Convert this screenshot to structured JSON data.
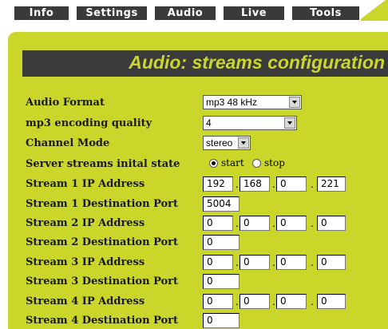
{
  "tabs": [
    "Info",
    "Settings",
    "Audio",
    "Live",
    "Tools"
  ],
  "page_title": "Audio: streams configuration",
  "form": {
    "audio_format": {
      "label": "Audio Format",
      "value": "mp3 48 kHz"
    },
    "mp3_quality": {
      "label": "mp3 encoding quality",
      "value": "4"
    },
    "channel_mode": {
      "label": "Channel Mode",
      "value": "stereo"
    },
    "server_state": {
      "label": "Server streams inital state",
      "options": [
        "start",
        "stop"
      ],
      "selected": "start"
    },
    "stream1_ip": {
      "label": "Stream 1 IP Address",
      "octets": [
        "192",
        "168",
        "0",
        "221"
      ]
    },
    "stream1_port": {
      "label": "Stream 1 Destination Port",
      "value": "5004"
    },
    "stream2_ip": {
      "label": "Stream 2 IP Address",
      "octets": [
        "0",
        "0",
        "0",
        "0"
      ]
    },
    "stream2_port": {
      "label": "Stream 2 Destination Port",
      "value": "0"
    },
    "stream3_ip": {
      "label": "Stream 3 IP Address",
      "octets": [
        "0",
        "0",
        "0",
        "0"
      ]
    },
    "stream3_port": {
      "label": "Stream 3 Destination Port",
      "value": "0"
    },
    "stream4_ip": {
      "label": "Stream 4 IP Address",
      "octets": [
        "0",
        "0",
        "0",
        "0"
      ]
    },
    "stream4_port": {
      "label": "Stream 4 Destination Port",
      "value": "0"
    }
  },
  "colors": {
    "accent": "#cbd62a",
    "dark": "#3b3b3b"
  },
  "icons": {
    "dropdown": "chevron-down-icon",
    "radio": "radio-button"
  }
}
